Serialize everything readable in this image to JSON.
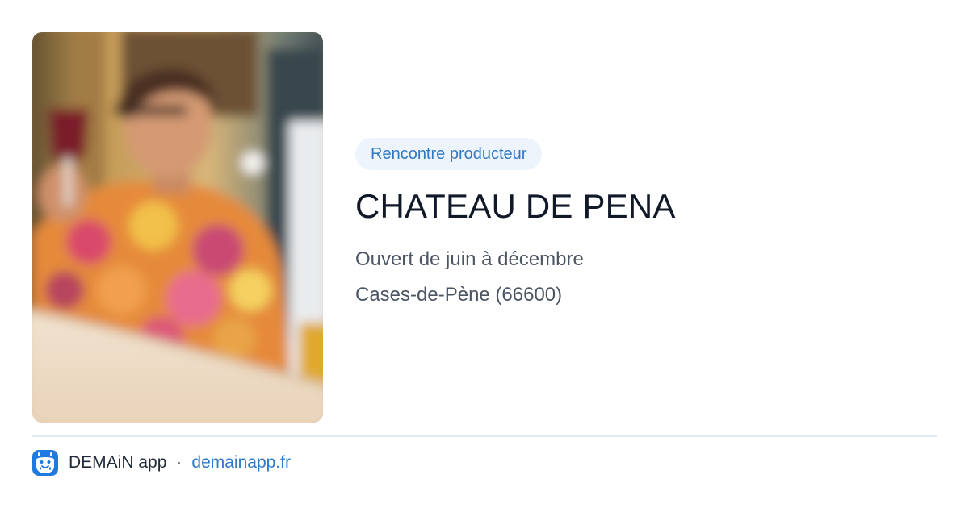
{
  "card": {
    "tag": "Rencontre producteur",
    "title": "CHATEAU DE PENA",
    "opening": "Ouvert de juin à décembre",
    "location": "Cases-de-Pène (66600)"
  },
  "footer": {
    "app_name": "DEMAiN app",
    "separator": "·",
    "site": "demainapp.fr"
  },
  "photo": {
    "subject": "woman holding a glass of red wine at a counter (blurred)"
  },
  "colors": {
    "accent": "#2f79c6",
    "tag_background": "#eef4fc",
    "title": "#111827",
    "muted_text": "#4b5563",
    "divider": "#e3ecef",
    "logo": "#1f7ae0"
  }
}
